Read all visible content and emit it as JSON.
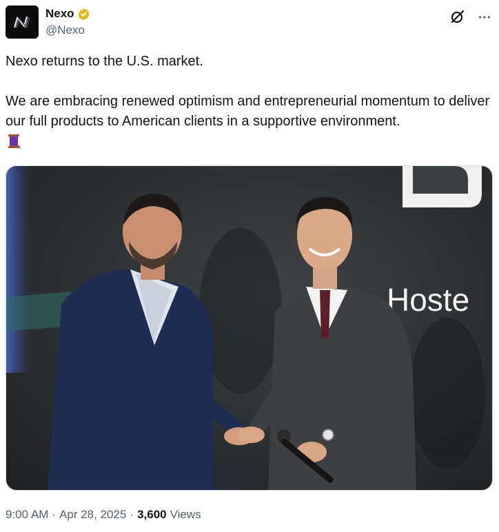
{
  "author": {
    "display_name": "Nexo",
    "handle": "@Nexo",
    "avatar_icon": "nexo-logo-icon",
    "verified_badge": "gold-verified-badge-icon",
    "verified_color": "#e2b719"
  },
  "header_actions": {
    "grok_icon": "grok-icon",
    "more_icon": "more-options-icon"
  },
  "tweet": {
    "line1": "Nexo returns to the U.S. market.",
    "line2": "We are embracing renewed optimism and entrepreneurial momentum to deliver our full products to American clients in a supportive environment.",
    "emoji": "thread-spool-emoji"
  },
  "media": {
    "stage_text": "Hoste",
    "description_icon": "photo"
  },
  "meta": {
    "time": "9:00 AM",
    "separator": "·",
    "date": "Apr 28, 2025",
    "views_count": "3,600",
    "views_label": "Views"
  }
}
